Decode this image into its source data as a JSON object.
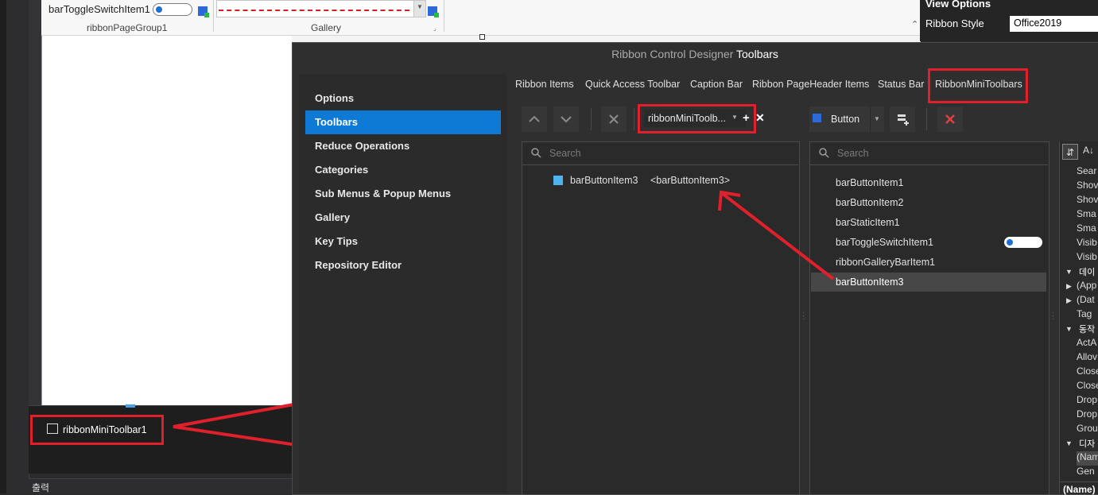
{
  "ribbon": {
    "toggle_item_label": "barToggleSwitchItem1",
    "group1_label": "ribbonPageGroup1",
    "gallery_label": "Gallery"
  },
  "view_options": {
    "title": "View Options",
    "ribbon_style_label": "Ribbon Style",
    "ribbon_style_value": "Office2019"
  },
  "mini_toolbar": {
    "label": "ribbonMiniToolbar1"
  },
  "output_label": "출력",
  "dialog": {
    "title_prefix": "Ribbon Control Designer",
    "title_section": "Toolbars",
    "nav": [
      "Options",
      "Toolbars",
      "Reduce Operations",
      "Categories",
      "Sub Menus & Popup Menus",
      "Gallery",
      "Key Tips",
      "Repository Editor"
    ],
    "tabs": [
      "Ribbon Items",
      "Quick Access Toolbar",
      "Caption Bar",
      "Ribbon PageHeader Items",
      "Status Bar",
      "RibbonMiniToolbars"
    ],
    "toolbar_combo_value": "ribbonMiniToolb...",
    "item_type_value": "Button",
    "left_search_placeholder": "Search",
    "right_search_placeholder": "Search",
    "toolbar_links": [
      {
        "name": "barButtonItem3",
        "caption": "<barButtonItem3>"
      }
    ],
    "items": [
      "barButtonItem1",
      "barButtonItem2",
      "barStaticItem1",
      "barToggleSwitchItem1",
      "ribbonGalleryBarItem1",
      "barButtonItem3"
    ]
  },
  "properties": {
    "rows_a": [
      "Sear",
      "Shov",
      "Shov",
      "Sma",
      "Sma",
      "Visib",
      "Visib"
    ],
    "cat_data": "데이",
    "rows_b": [
      "(App",
      "(Dat",
      "Tag"
    ],
    "cat_behavior": "동작",
    "rows_c": [
      "ActA",
      "Allov",
      "Close",
      "Close",
      "Drop",
      "Drop",
      "Grou"
    ],
    "cat_design": "디자",
    "rows_d": [
      "(Nam",
      "Gen"
    ],
    "footer": "(Name)"
  },
  "colors": {
    "accent": "#0f7ad6",
    "highlight": "#e0202a",
    "dialog_bg": "#2f2f2f"
  }
}
